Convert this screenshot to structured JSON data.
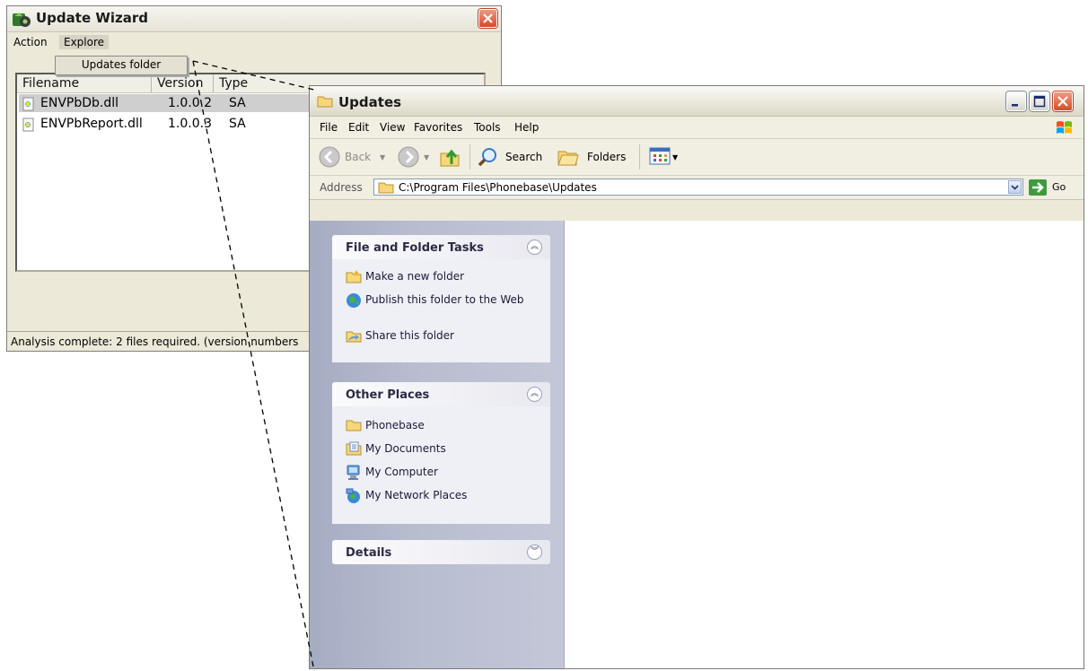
{
  "wizard": {
    "title": "Update Wizard",
    "menu": [
      "Action",
      "Explore"
    ],
    "dropdown_item": "Updates folder",
    "columns": [
      "Filename",
      "Version",
      "Type"
    ],
    "rows": [
      {
        "filename": "ENVPbDb.dll",
        "version": "1.0.0.2",
        "type": "SA"
      },
      {
        "filename": "ENVPbReport.dll",
        "version": "1.0.0.3",
        "type": "SA"
      }
    ],
    "status": "Analysis complete: 2 files required. (version numbers"
  },
  "explorer": {
    "title": "Updates",
    "menu": {
      "file": "File",
      "edit": "Edit",
      "view": "View",
      "favorites": "Favorites",
      "tools": "Tools",
      "help": "Help"
    },
    "toolbar": {
      "back": "Back",
      "search": "Search",
      "folders": "Folders"
    },
    "address": {
      "label": "Address",
      "value": "C:\\Program Files\\Phonebase\\Updates",
      "go": "Go"
    },
    "file_folder_tasks": {
      "title": "File and Folder Tasks",
      "items": [
        "Make a new folder",
        "Publish this folder to the Web",
        "Share this folder"
      ]
    },
    "other_places": {
      "title": "Other Places",
      "items": [
        "Phonebase",
        "My Documents",
        "My Computer",
        "My Network Places"
      ]
    },
    "details": {
      "title": "Details"
    }
  },
  "colors": {
    "selection": "#cfcfcf",
    "task_pane": "#b7bccf",
    "close_red": "#d9482a",
    "go_green": "#3f9a3f"
  }
}
